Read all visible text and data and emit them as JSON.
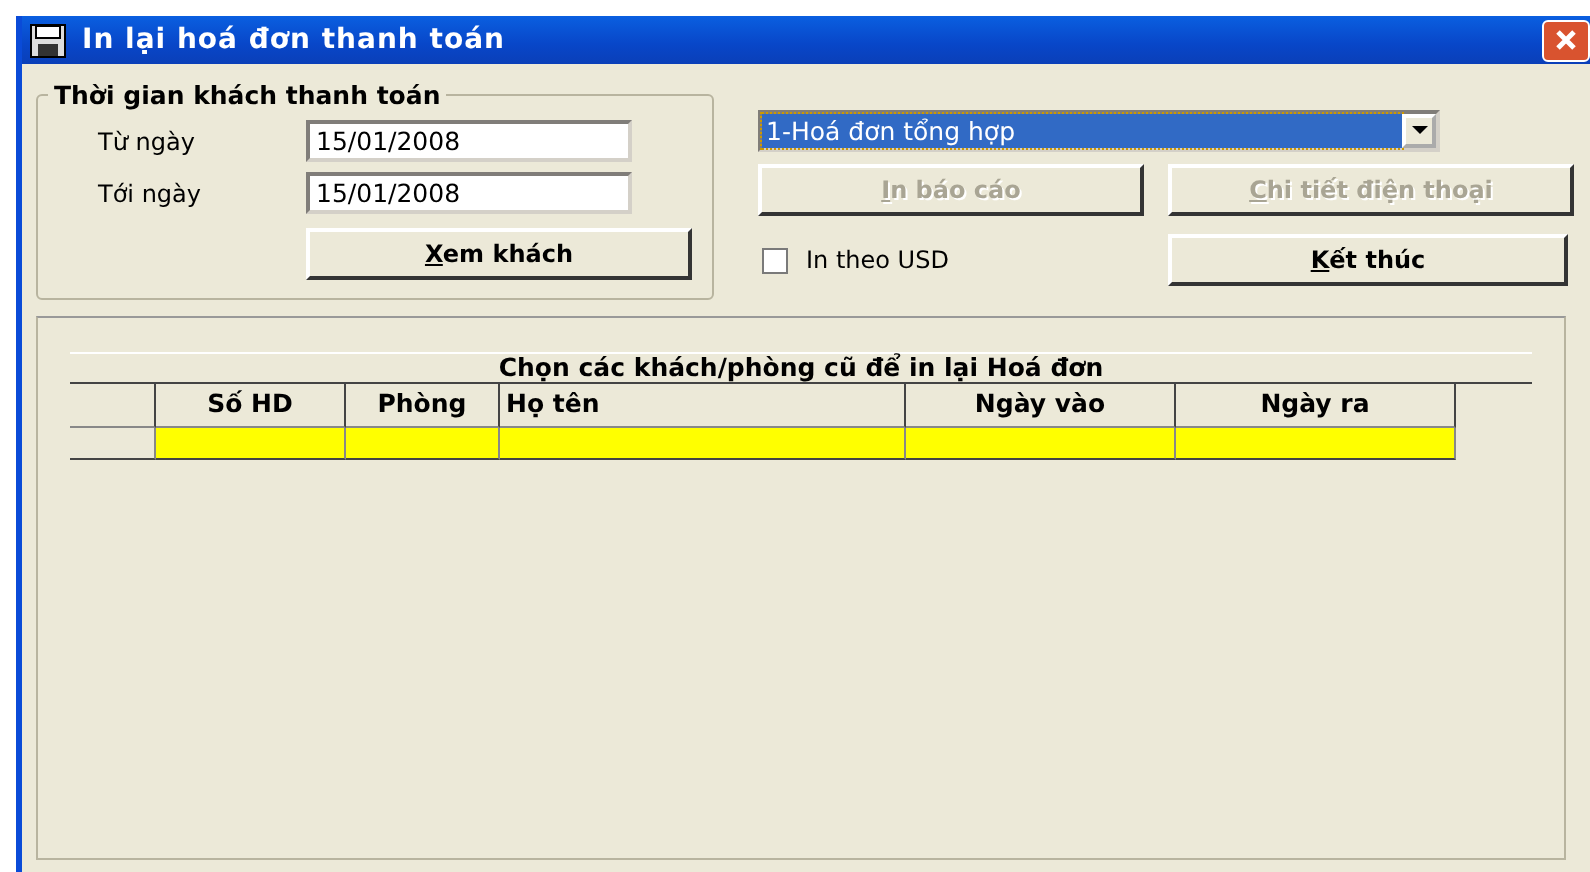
{
  "window": {
    "title": "In lại hoá đơn thanh toán"
  },
  "period_group": {
    "title": "Thời gian khách thanh toán",
    "fields": [
      {
        "label": "Từ ngày",
        "value": "15/01/2008"
      },
      {
        "label": "Tới ngày",
        "value": "15/01/2008"
      }
    ],
    "button": {
      "label": "Xem khách",
      "mnemonic": true,
      "disabled": false
    }
  },
  "report_select": {
    "value": "1-Hoá đơn tổng hợp",
    "focused": true
  },
  "buttons": [
    {
      "label": "In báo cáo",
      "mnemonic": true,
      "disabled": true
    },
    {
      "label": "Chi tiết điện thoại",
      "mnemonic": true,
      "disabled": true
    },
    {
      "label": "Kết thúc",
      "mnemonic": true,
      "disabled": false
    }
  ],
  "usd_checkbox": {
    "label": "In theo USD",
    "checked": false
  },
  "table": {
    "title": "Chọn các khách/phòng cũ để in lại Hoá đơn",
    "columns": [
      "Số HD",
      "Phòng",
      "Họ tên",
      "Ngày vào",
      "Ngày ra"
    ],
    "edit_row": {
      "highlighted": true
    }
  }
}
